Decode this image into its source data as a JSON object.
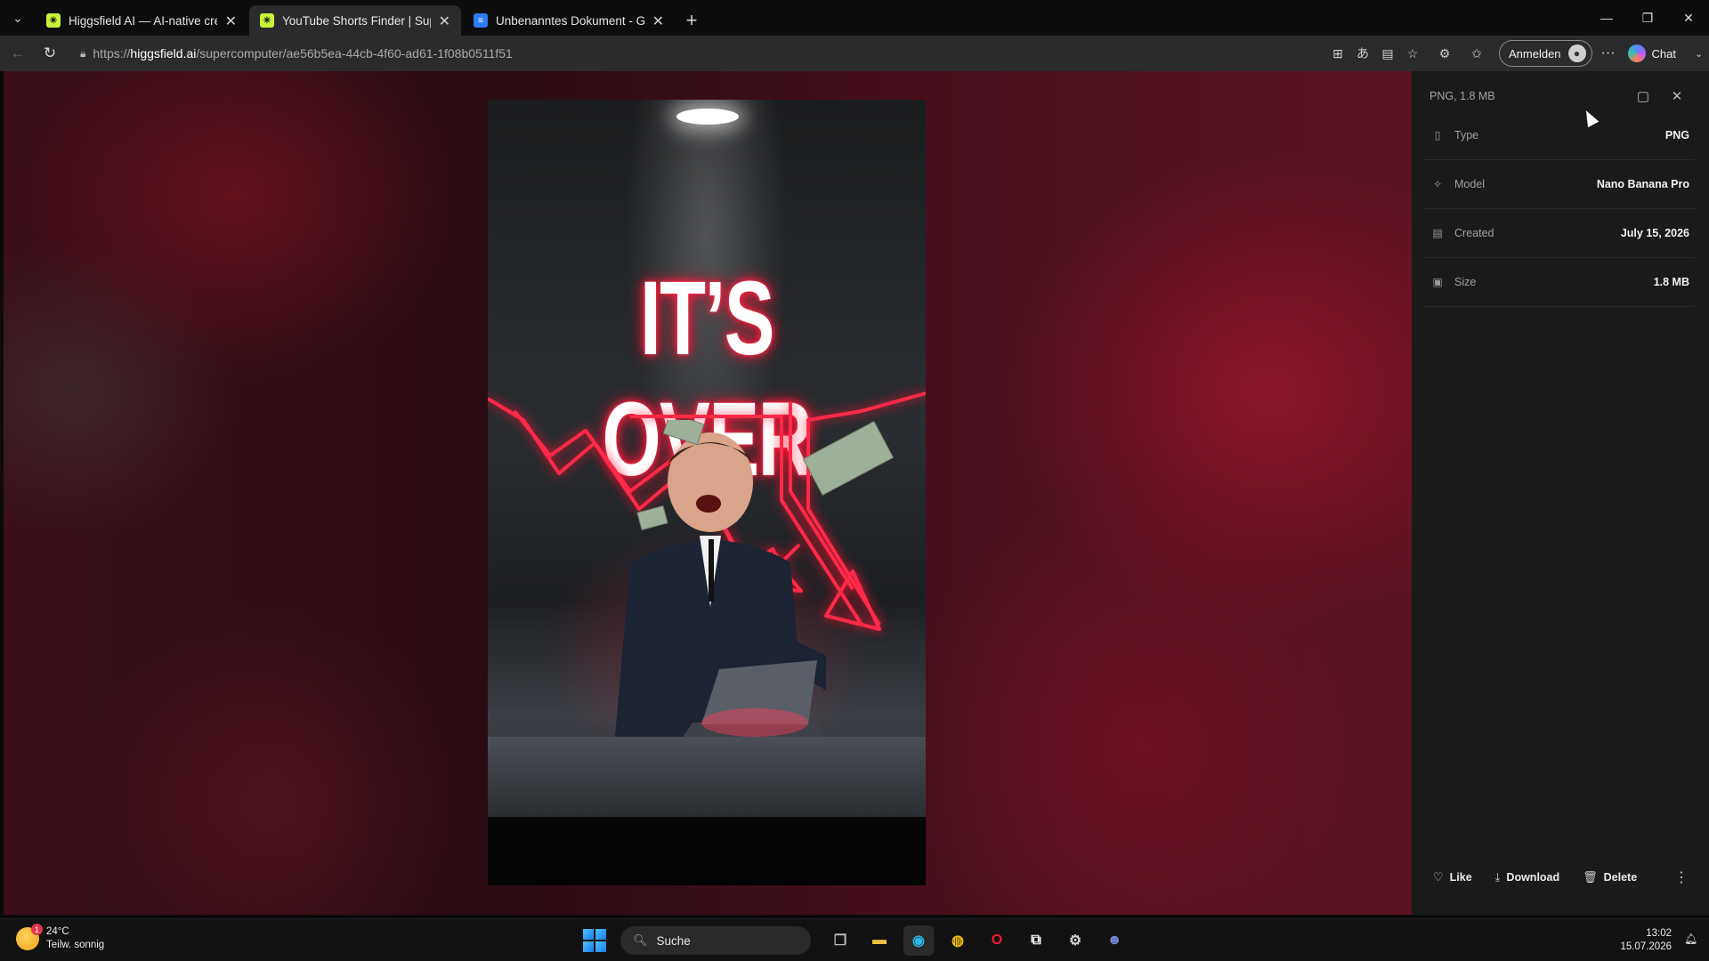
{
  "browser": {
    "tabs": [
      {
        "title": "Higgsfield AI — AI-native creative",
        "active": false,
        "favicon": "higgsfield-favicon"
      },
      {
        "title": "YouTube Shorts Finder | Supercom",
        "active": true,
        "favicon": "higgsfield-favicon"
      },
      {
        "title": "Unbenanntes Dokument - Google",
        "active": false,
        "favicon": "google-docs-favicon"
      }
    ],
    "url_prefix": "https://",
    "url_host": "higgsfield.ai",
    "url_path": "/supercomputer/ae56b5ea-44cb-4f60-ad61-1f08b0511f51",
    "signin_label": "Anmelden",
    "chat_label": "Chat"
  },
  "viewer": {
    "headline": "IT’S OVER",
    "accent_color": "#ff2040"
  },
  "panel": {
    "header": "PNG, 1.8 MB",
    "rows": [
      {
        "key": "Type",
        "value": "PNG",
        "icon": "file-icon"
      },
      {
        "key": "Model",
        "value": "Nano Banana Pro",
        "icon": "sparkle-icon"
      },
      {
        "key": "Created",
        "value": "July 15, 2026",
        "icon": "calendar-icon"
      },
      {
        "key": "Size",
        "value": "1.8 MB",
        "icon": "disk-icon"
      }
    ],
    "actions": {
      "like": "Like",
      "download": "Download",
      "delete": "Delete"
    }
  },
  "taskbar": {
    "weather_temp": "24°C",
    "weather_desc": "Teilw. sonnig",
    "weather_badge": "1",
    "search_label": "Suche",
    "time": "13:02",
    "date": "15.07.2026"
  }
}
